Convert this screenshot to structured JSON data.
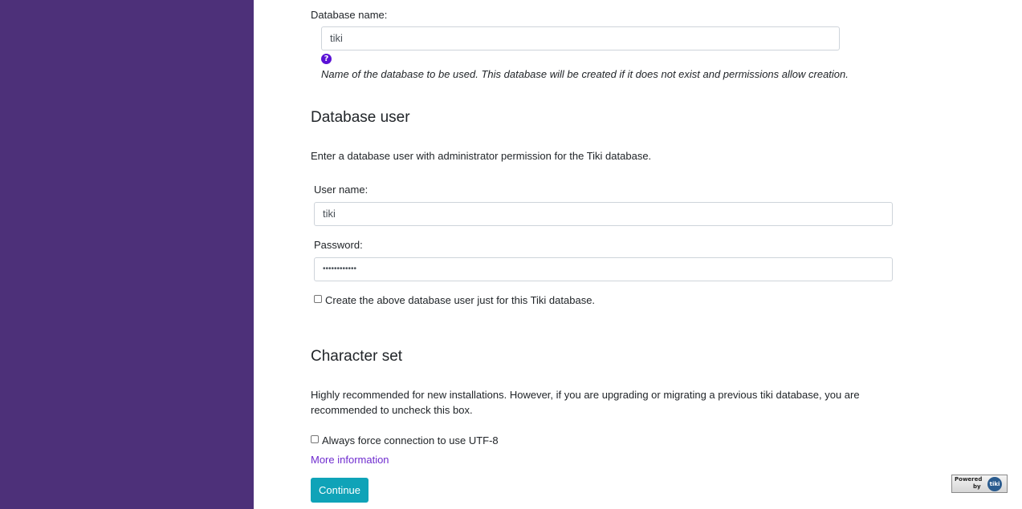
{
  "database_name": {
    "label": "Database name:",
    "value": "tiki",
    "help_icon": "question-circle-icon",
    "help_text": "Name of the database to be used. This database will be created if it does not exist and permissions allow creation."
  },
  "database_user": {
    "heading": "Database user",
    "description": "Enter a database user with administrator permission for the Tiki database.",
    "username_label": "User name:",
    "username_value": "tiki",
    "password_label": "Password:",
    "password_value": "••••••••••••",
    "create_user_label": "Create the above database user just for this Tiki database."
  },
  "character_set": {
    "heading": "Character set",
    "description": "Highly recommended for new installations. However, if you are upgrading or migrating a previous tiki database, you are recommended to uncheck this box.",
    "force_utf8_label": "Always force connection to use UTF-8",
    "more_info_link": "More information"
  },
  "continue_button": "Continue",
  "powered_by": {
    "line1": "Powered",
    "line2": "by",
    "logo_text": "tiki"
  },
  "colors": {
    "sidebar": "#4d3079",
    "accent": "#0fa3b8",
    "link": "#6f2ccf"
  }
}
